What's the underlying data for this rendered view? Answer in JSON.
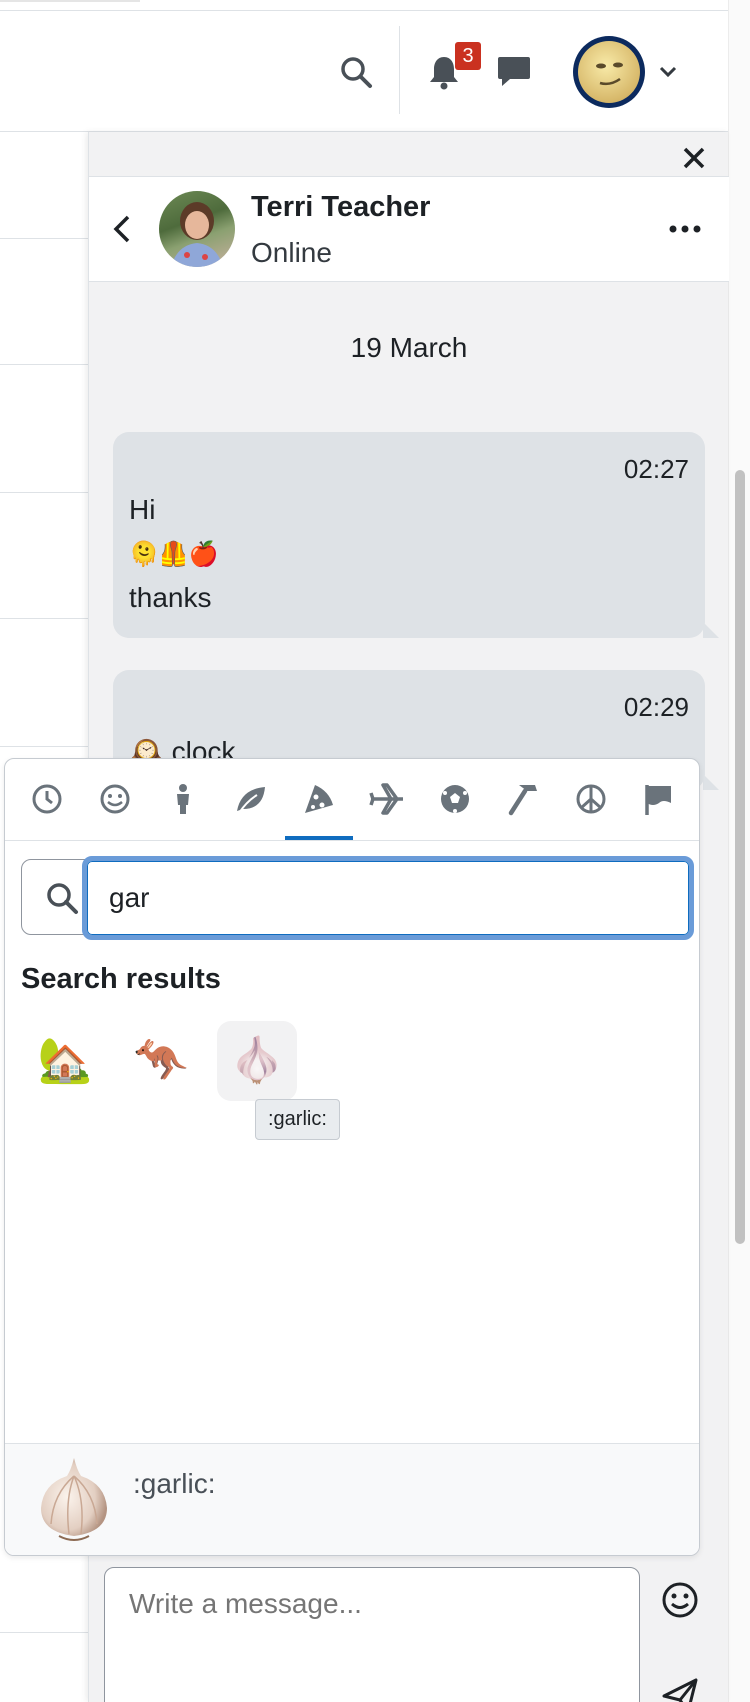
{
  "navbar": {
    "notification_count": "3",
    "icons": [
      "search-icon",
      "bell-icon",
      "chat-icon",
      "chevron-down-icon"
    ]
  },
  "drawer": {
    "contact": {
      "name": "Terri Teacher",
      "status": "Online"
    },
    "date": "19 March",
    "messages": [
      {
        "time": "02:27",
        "lines": [
          "Hi",
          "🫠🦺🍎",
          "thanks"
        ]
      },
      {
        "time": "02:29",
        "lines": [
          "🕰️ clock"
        ]
      }
    ],
    "compose": {
      "placeholder": "Write a message..."
    }
  },
  "emoji_picker": {
    "categories": [
      "recent",
      "smileys",
      "people",
      "nature",
      "food",
      "travel",
      "activities",
      "objects",
      "symbols",
      "flags"
    ],
    "active_category": "food",
    "search": {
      "value": "gar"
    },
    "results_heading": "Search results",
    "results": [
      {
        "emoji": "🏡",
        "name": ":house_with_garden:"
      },
      {
        "emoji": "🦘",
        "name": ":kangaroo:"
      },
      {
        "emoji": "🧄",
        "name": ":garlic:"
      }
    ],
    "tooltip": ":garlic:",
    "preview": {
      "emoji": "🧄",
      "name": ":garlic:"
    }
  }
}
